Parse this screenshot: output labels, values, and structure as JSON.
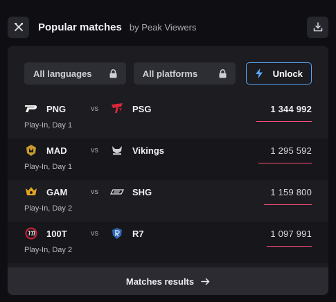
{
  "header": {
    "title": "Popular matches",
    "subtitle": "by Peak Viewers"
  },
  "filters": {
    "languages_label": "All languages",
    "platforms_label": "All platforms",
    "unlock_label": "Unlock"
  },
  "matches": [
    {
      "team1": "PNG",
      "team2": "PSG",
      "vs": "vs",
      "stage": "Play-In, Day 1",
      "viewers": "1 344 992",
      "viewers_value": 1344992
    },
    {
      "team1": "MAD",
      "team2": "Vikings",
      "vs": "vs",
      "stage": "Play-In, Day 1",
      "viewers": "1 295 592",
      "viewers_value": 1295592
    },
    {
      "team1": "GAM",
      "team2": "SHG",
      "vs": "vs",
      "stage": "Play-In, Day 2",
      "viewers": "1 159 800",
      "viewers_value": 1159800
    },
    {
      "team1": "100T",
      "team2": "R7",
      "vs": "vs",
      "stage": "Play-In, Day 2",
      "viewers": "1 097 991",
      "viewers_value": 1097991
    }
  ],
  "footer": {
    "results_label": "Matches results"
  },
  "colors": {
    "accent_bar": "#ff4f78",
    "unlock_border": "#5aa8f5"
  }
}
